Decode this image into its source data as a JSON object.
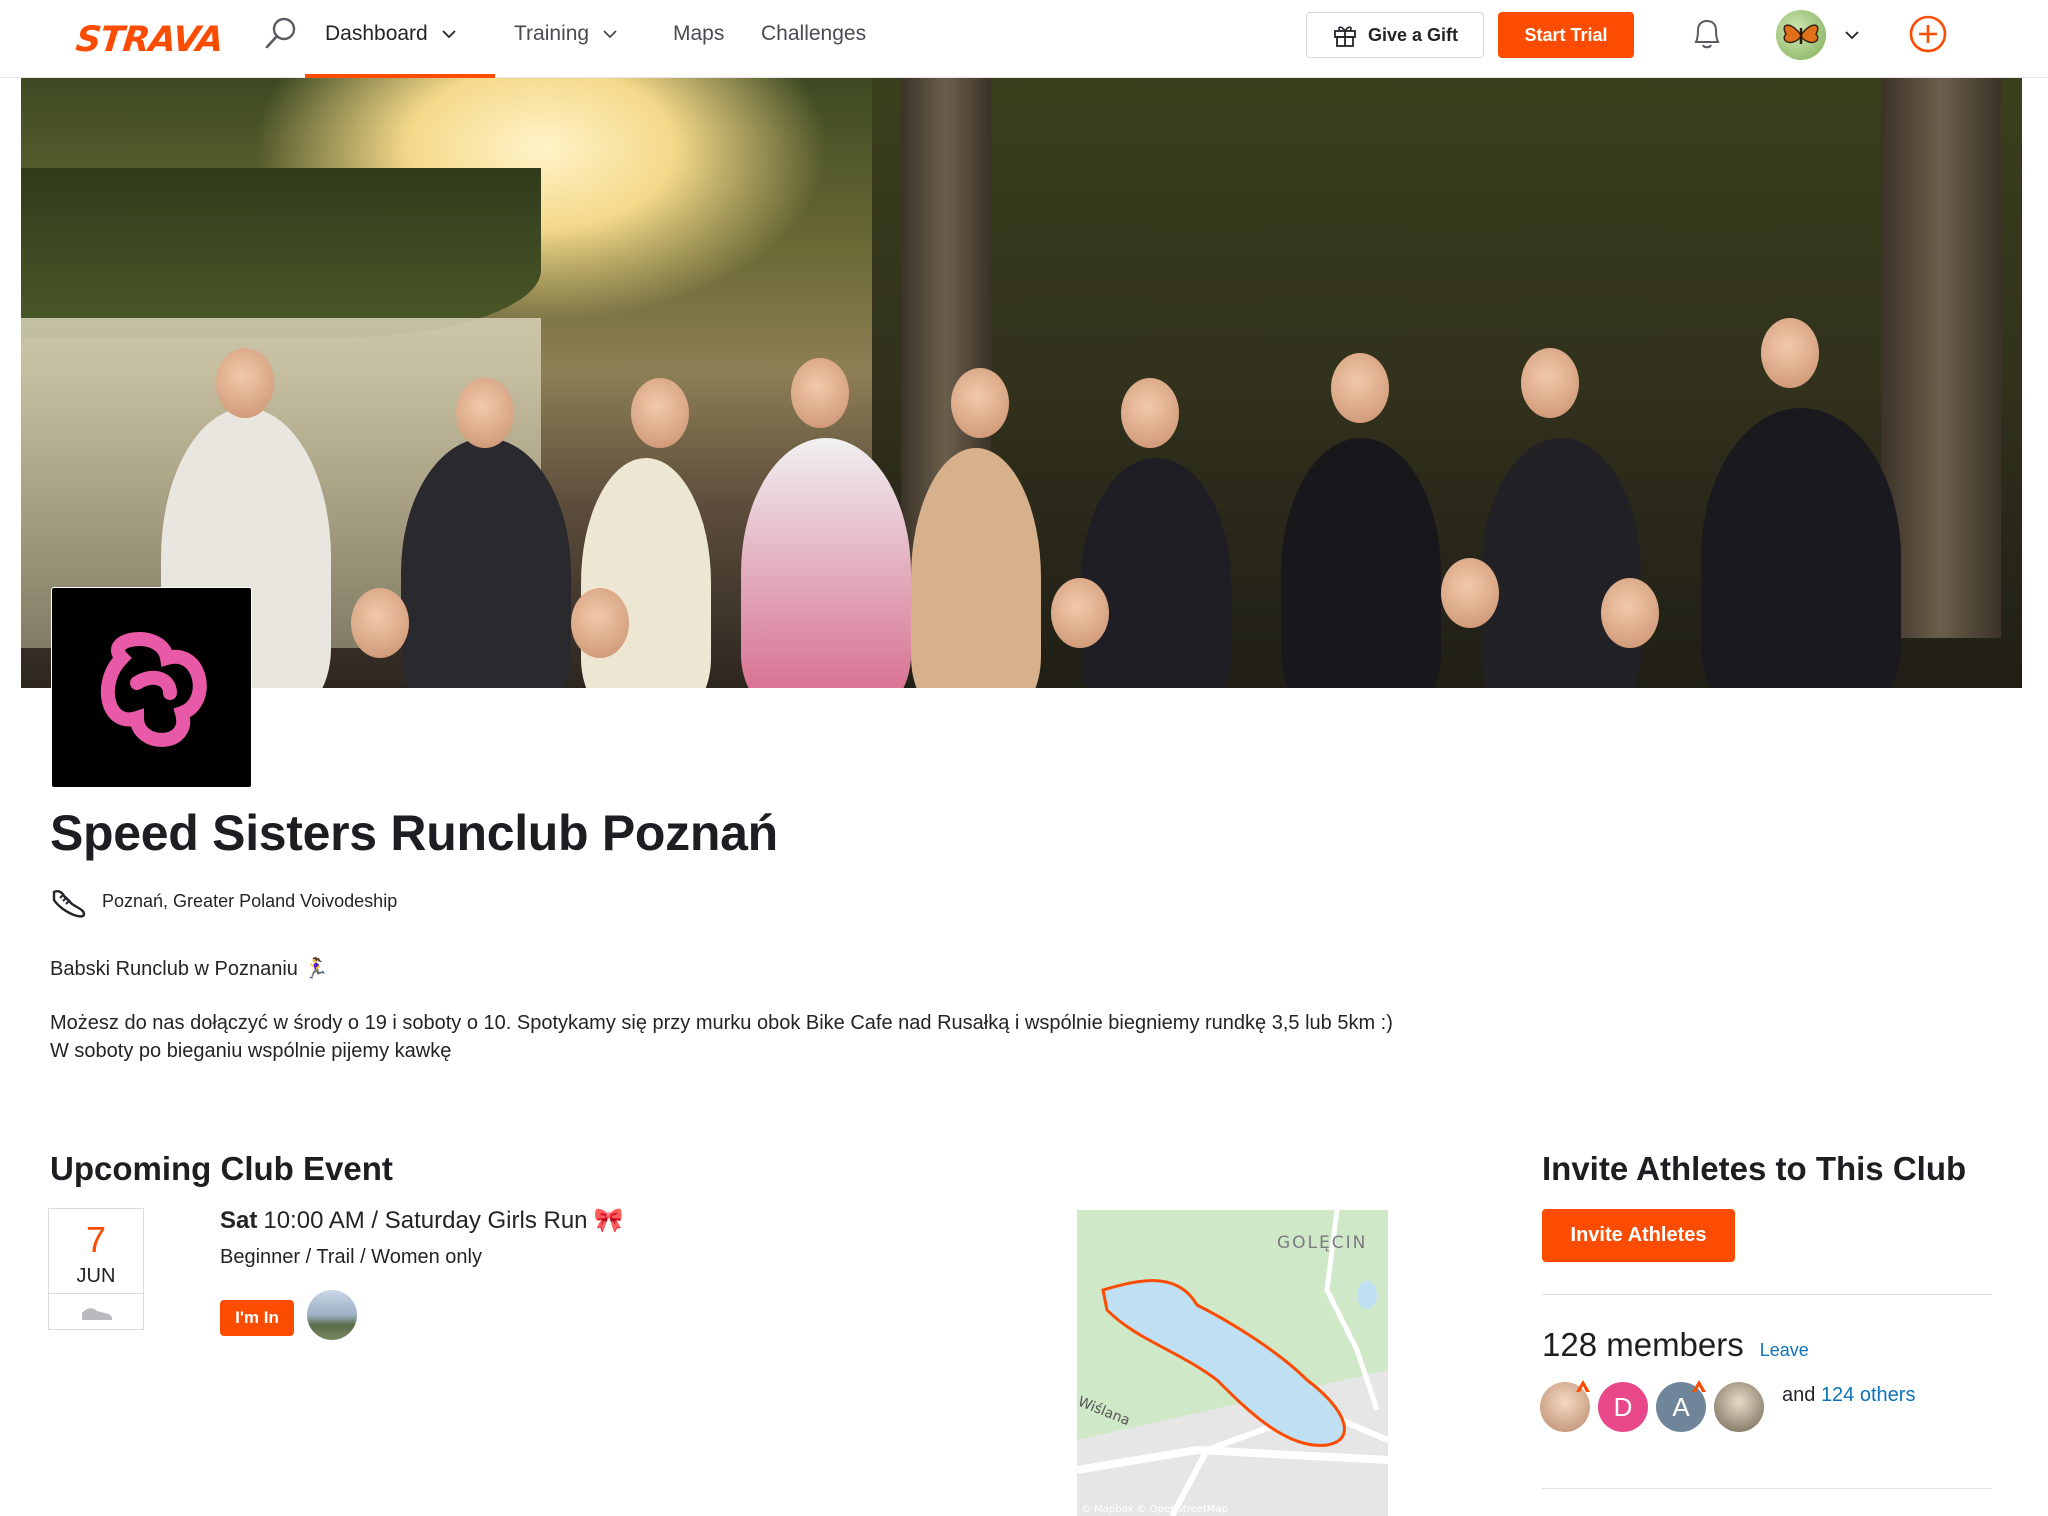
{
  "nav": {
    "logo": "STRAVA",
    "items": [
      {
        "label": "Dashboard",
        "has_chevron": true,
        "active": true
      },
      {
        "label": "Training",
        "has_chevron": true,
        "active": false
      },
      {
        "label": "Maps",
        "has_chevron": false,
        "active": false
      },
      {
        "label": "Challenges",
        "has_chevron": false,
        "active": false
      }
    ],
    "gift_label": "Give a Gift",
    "trial_label": "Start Trial",
    "icons": [
      "search-icon",
      "chevron-down-icon",
      "gift-icon",
      "bell-icon",
      "avatar",
      "plus-circle-icon"
    ],
    "accent_color": "#fc4c02"
  },
  "club": {
    "name": "Speed Sisters Runclub Poznań",
    "location": "Poznań, Greater Poland Voivodeship",
    "sport_icon": "running-shoe-icon",
    "description": {
      "line1": "Babski Runclub w Poznaniu 🏃‍♀️",
      "line2": "Możesz do nas dołączyć w środy o 19 i soboty o 10. Spotykamy się przy murku obok Bike Cafe nad Rusałką i wspólnie biegniemy rundkę 3,5 lub 5km :)",
      "line3": "W soboty po bieganiu wspólnie pijemy kawkę"
    }
  },
  "event": {
    "section_title": "Upcoming Club Event",
    "date_day": "7",
    "date_month": "JUN",
    "weekday": "Sat",
    "time_title": "10:00 AM / Saturday Girls Run",
    "emoji": "🎀",
    "subtitle": "Beginner / Trail / Women only",
    "rsvp_label": "I'm In",
    "map": {
      "label_area": "GOLĘCIN",
      "label_street": "Wiślana",
      "attribution": "© Mapbox © OpenStreetMap"
    }
  },
  "invite": {
    "section_title": "Invite Athletes to This Club",
    "button_label": "Invite Athletes",
    "members_count": "128 members",
    "leave_label": "Leave",
    "avatars": [
      {
        "type": "photo",
        "initial": "",
        "color": "#e8c9a8"
      },
      {
        "type": "initial",
        "initial": "D",
        "color": "#e8488a"
      },
      {
        "type": "initial",
        "initial": "A",
        "color": "#6f8599"
      },
      {
        "type": "photo",
        "initial": "",
        "color": "#b7aa8e"
      }
    ],
    "and_text": "and",
    "others_link": "124 others"
  }
}
